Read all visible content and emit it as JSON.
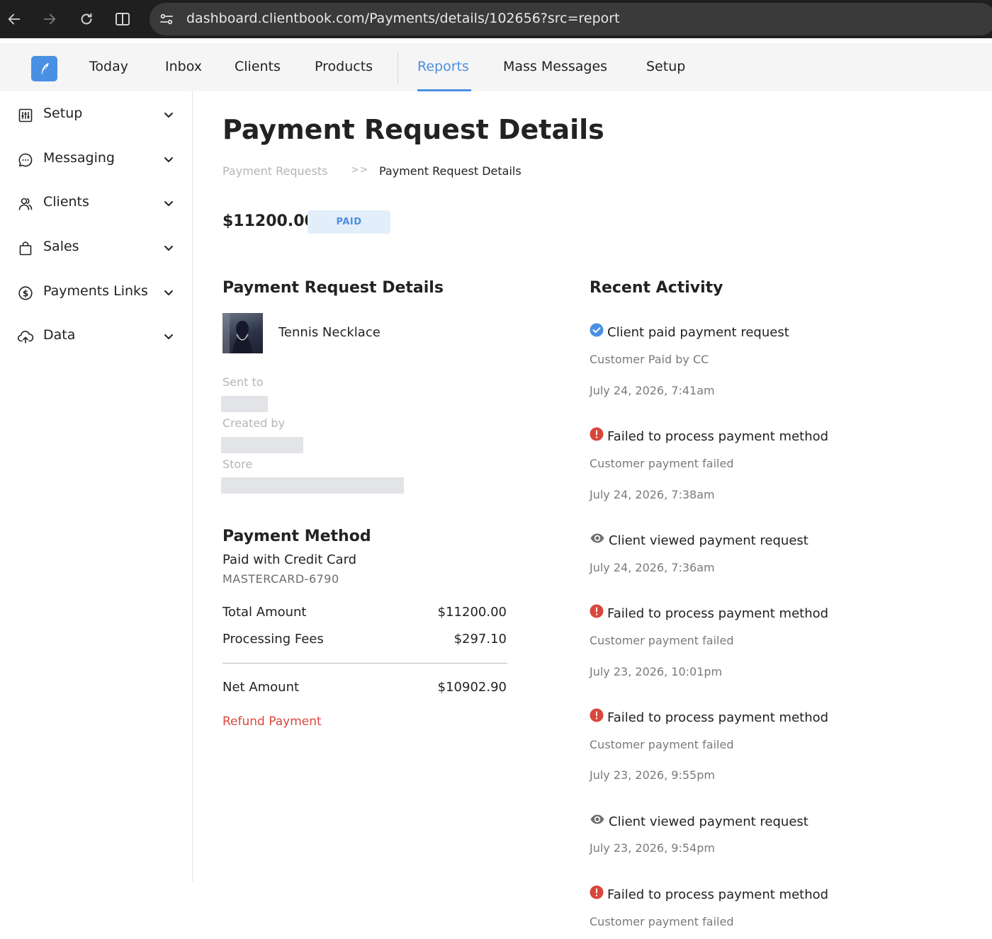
{
  "browser": {
    "url": "dashboard.clientbook.com/Payments/details/102656?src=report"
  },
  "nav": {
    "items": [
      {
        "label": "Today"
      },
      {
        "label": "Inbox"
      },
      {
        "label": "Clients"
      },
      {
        "label": "Products"
      },
      {
        "label": "Reports",
        "active": true
      },
      {
        "label": "Mass Messages"
      },
      {
        "label": "Setup"
      }
    ]
  },
  "sidebar": {
    "items": [
      {
        "label": "Setup",
        "icon": "sliders-icon"
      },
      {
        "label": "Messaging",
        "icon": "chat-bubble-icon"
      },
      {
        "label": "Clients",
        "icon": "people-icon"
      },
      {
        "label": "Sales",
        "icon": "shopping-bag-icon"
      },
      {
        "label": "Payments Links",
        "icon": "dollar-circle-icon"
      },
      {
        "label": "Data",
        "icon": "cloud-upload-icon"
      }
    ]
  },
  "page": {
    "title": "Payment Request Details",
    "breadcrumb": {
      "parent": "Payment Requests",
      "separator": ">>",
      "current": "Payment Request Details"
    },
    "amount": "$11200.00",
    "status": "PAID"
  },
  "details": {
    "heading": "Payment Request Details",
    "product_name": "Tennis Necklace",
    "sent_to_label": "Sent to",
    "created_by_label": "Created by",
    "store_label": "Store"
  },
  "payment_method": {
    "heading": "Payment Method",
    "type": "Paid with Credit Card",
    "card": "MASTERCARD-6790",
    "rows": [
      {
        "label": "Total Amount",
        "value": "$11200.00"
      },
      {
        "label": "Processing Fees",
        "value": "$297.10"
      }
    ],
    "net": {
      "label": "Net Amount",
      "value": "$10902.90"
    },
    "refund_label": "Refund Payment"
  },
  "activity": {
    "heading": "Recent Activity",
    "items": [
      {
        "icon": "check-circle-icon",
        "title": "Client paid payment request",
        "sub": "Customer Paid by CC",
        "time": "July 24, 2026, 7:41am"
      },
      {
        "icon": "error-circle-icon",
        "title": "Failed to process payment method",
        "sub": "Customer payment failed",
        "time": "July 24, 2026, 7:38am"
      },
      {
        "icon": "eye-icon",
        "title": "Client viewed payment request",
        "sub": "",
        "time": "July 24, 2026, 7:36am"
      },
      {
        "icon": "error-circle-icon",
        "title": "Failed to process payment method",
        "sub": "Customer payment failed",
        "time": "July 23, 2026, 10:01pm"
      },
      {
        "icon": "error-circle-icon",
        "title": "Failed to process payment method",
        "sub": "Customer payment failed",
        "time": "July 23, 2026, 9:55pm"
      },
      {
        "icon": "eye-icon",
        "title": "Client viewed payment request",
        "sub": "",
        "time": "July 23, 2026, 9:54pm"
      },
      {
        "icon": "error-circle-icon",
        "title": "Failed to process payment method",
        "sub": "Customer payment failed",
        "time": ""
      }
    ]
  },
  "colors": {
    "accent": "#4a90e2",
    "error": "#d9473c",
    "paid_badge_bg": "#e3eefb"
  }
}
